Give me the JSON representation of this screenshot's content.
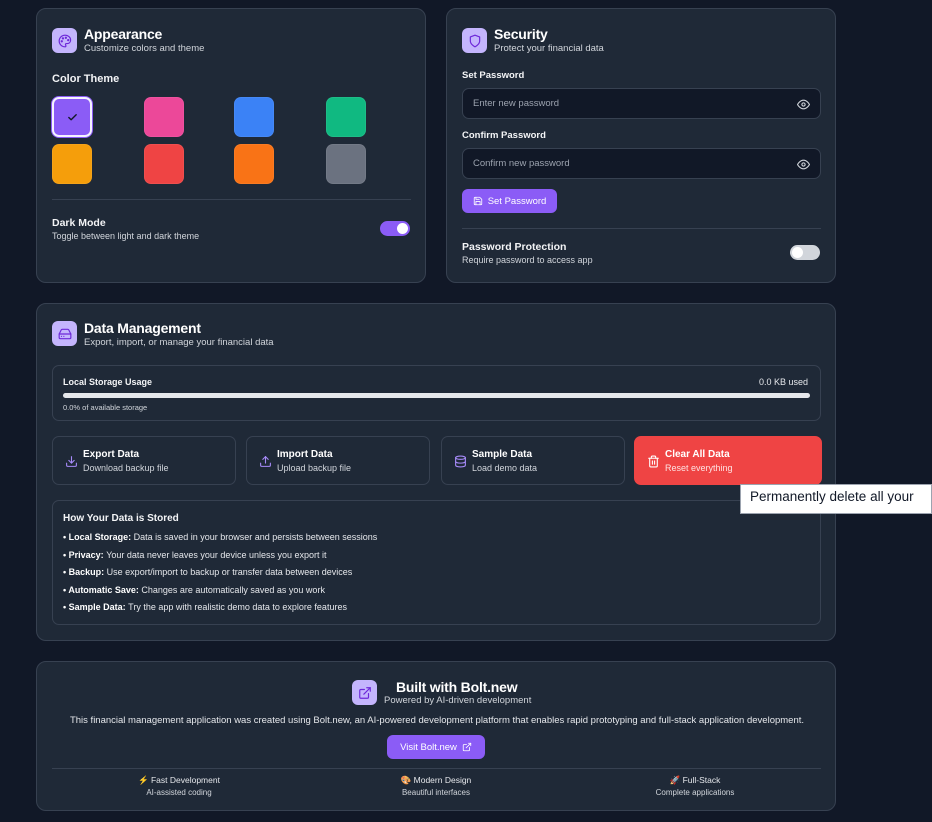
{
  "appearance": {
    "title": "Appearance",
    "subtitle": "Customize colors and theme",
    "icon": "palette-icon",
    "color_theme_label": "Color Theme",
    "swatches": [
      {
        "name": "violet",
        "color": "#8b5cf6",
        "selected": true
      },
      {
        "name": "pink",
        "color": "#ec4899",
        "selected": false
      },
      {
        "name": "blue",
        "color": "#3b82f6",
        "selected": false
      },
      {
        "name": "emerald",
        "color": "#10b981",
        "selected": false
      },
      {
        "name": "amber",
        "color": "#f59e0b",
        "selected": false
      },
      {
        "name": "red",
        "color": "#ef4444",
        "selected": false
      },
      {
        "name": "orange",
        "color": "#f97316",
        "selected": false
      },
      {
        "name": "gray",
        "color": "#6b7280",
        "selected": false
      }
    ],
    "dark_mode_label": "Dark Mode",
    "dark_mode_desc": "Toggle between light and dark theme",
    "dark_mode_on": true
  },
  "security": {
    "title": "Security",
    "subtitle": "Protect your financial data",
    "icon": "shield-icon",
    "set_password_label": "Set Password",
    "set_password_placeholder": "Enter new password",
    "confirm_password_label": "Confirm Password",
    "confirm_password_placeholder": "Confirm new password",
    "set_password_button": "Set Password",
    "protection_label": "Password Protection",
    "protection_desc": "Require password to access app",
    "protection_on": false
  },
  "data_management": {
    "title": "Data Management",
    "subtitle": "Export, import, or manage your financial data",
    "icon": "hard-drive-icon",
    "storage": {
      "label": "Local Storage Usage",
      "used": "0.0 KB used",
      "percent_text": "0.0% of available storage",
      "fraction": 0.0
    },
    "actions": [
      {
        "key": "export",
        "title": "Export Data",
        "subtitle": "Download backup file",
        "icon": "download-icon"
      },
      {
        "key": "import",
        "title": "Import Data",
        "subtitle": "Upload backup file",
        "icon": "upload-icon"
      },
      {
        "key": "sample",
        "title": "Sample Data",
        "subtitle": "Load demo data",
        "icon": "database-icon"
      },
      {
        "key": "clear",
        "title": "Clear All Data",
        "subtitle": "Reset everything",
        "icon": "trash-icon"
      }
    ],
    "tooltip": "Permanently delete all your",
    "info": {
      "title": "How Your Data is Stored",
      "items": [
        {
          "label": "Local Storage:",
          "text": "Data is saved in your browser and persists between sessions"
        },
        {
          "label": "Privacy:",
          "text": "Your data never leaves your device unless you export it"
        },
        {
          "label": "Backup:",
          "text": "Use export/import to backup or transfer data between devices"
        },
        {
          "label": "Automatic Save:",
          "text": "Changes are automatically saved as you work"
        },
        {
          "label": "Sample Data:",
          "text": "Try the app with realistic demo data to explore features"
        }
      ]
    }
  },
  "bolt": {
    "title": "Built with Bolt.new",
    "subtitle": "Powered by AI-driven development",
    "icon": "external-link-icon",
    "description": "This financial management application was created using Bolt.new, an AI-powered development platform that enables rapid prototyping and full-stack application development.",
    "button": "Visit Bolt.new",
    "features": [
      {
        "emoji": "⚡",
        "title": "Fast Development",
        "subtitle": "AI-assisted coding"
      },
      {
        "emoji": "🎨",
        "title": "Modern Design",
        "subtitle": "Beautiful interfaces"
      },
      {
        "emoji": "🚀",
        "title": "Full-Stack",
        "subtitle": "Complete applications"
      }
    ]
  },
  "colors": {
    "accent": "#8b5cf6",
    "danger": "#ef4444",
    "page_bg": "#111827",
    "card_bg": "#1f2937"
  }
}
